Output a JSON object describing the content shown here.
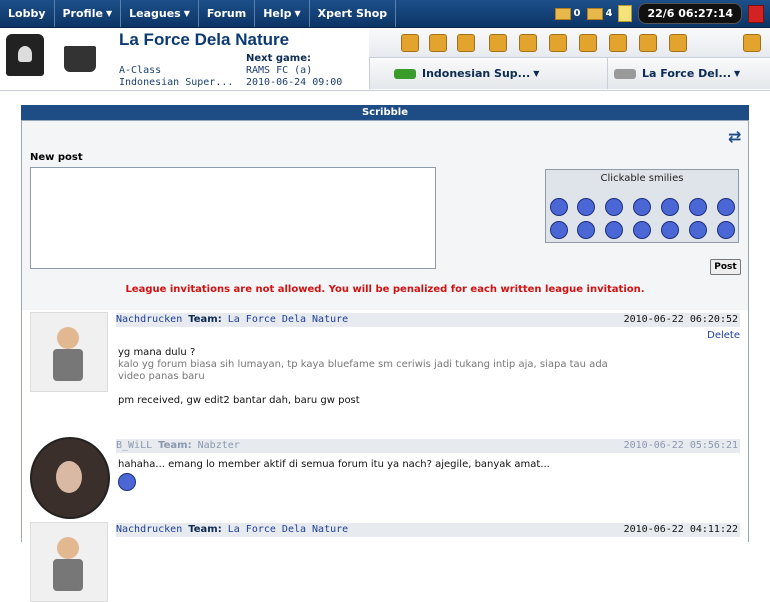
{
  "nav": {
    "items": [
      {
        "label": "Lobby",
        "arrow": false
      },
      {
        "label": "Profile",
        "arrow": true
      },
      {
        "label": "Leagues",
        "arrow": true
      },
      {
        "label": "Forum",
        "arrow": false
      },
      {
        "label": "Help",
        "arrow": true
      },
      {
        "label": "Xpert Shop",
        "arrow": false
      }
    ],
    "mail_count": "0",
    "wire_count": "4",
    "clock": "22/6 06:27:14",
    "arrow_glyph": "▼"
  },
  "team": {
    "name": "La Force Dela Nature",
    "division": "A-Class",
    "league": "Indonesian Super...",
    "next_game_label": "Next game:",
    "next_game_opponent": "RAMS FC (a)",
    "next_game_time": "2010-06-24 09:00",
    "league_dropdown": "Indonesian Sup...",
    "team_dropdown": "La Force Del..."
  },
  "scribble": {
    "title": "Scribble",
    "new_post_label": "New post",
    "smilies_title": "Clickable smilies",
    "post_button": "Post",
    "warning": "League invitations are not allowed. You will be penalized for each written league invitation."
  },
  "posts": [
    {
      "author": "Nachdrucken",
      "team_label": "Team:",
      "team": "La Force Dela Nature",
      "date": "2010-06-22 06:20:52",
      "delete": "Delete",
      "lines": [
        "yg mana dulu ?",
        "kalo yg forum biasa sih lumayan, tp kaya bluefame sm ceriwis jadi tukang intip aja, siapa tau ada",
        "video panas baru",
        "pm received, gw edit2 bantar dah, baru gw post"
      ]
    },
    {
      "author": "B_WiLL",
      "team_label": "Team:",
      "team": "Nabzter",
      "date": "2010-06-22 05:56:21",
      "lines": [
        "hahaha... emang lo member aktif di semua forum itu ya nach? ajegile, banyak amat..."
      ]
    },
    {
      "author": "Nachdrucken",
      "team_label": "Team:",
      "team": "La Force Dela Nature",
      "date": "2010-06-22 04:11:22",
      "lines": []
    }
  ],
  "colors": {
    "nav_bg": "#0c3566",
    "title_blue": "#0c3a73",
    "warning_red": "#d21212"
  }
}
